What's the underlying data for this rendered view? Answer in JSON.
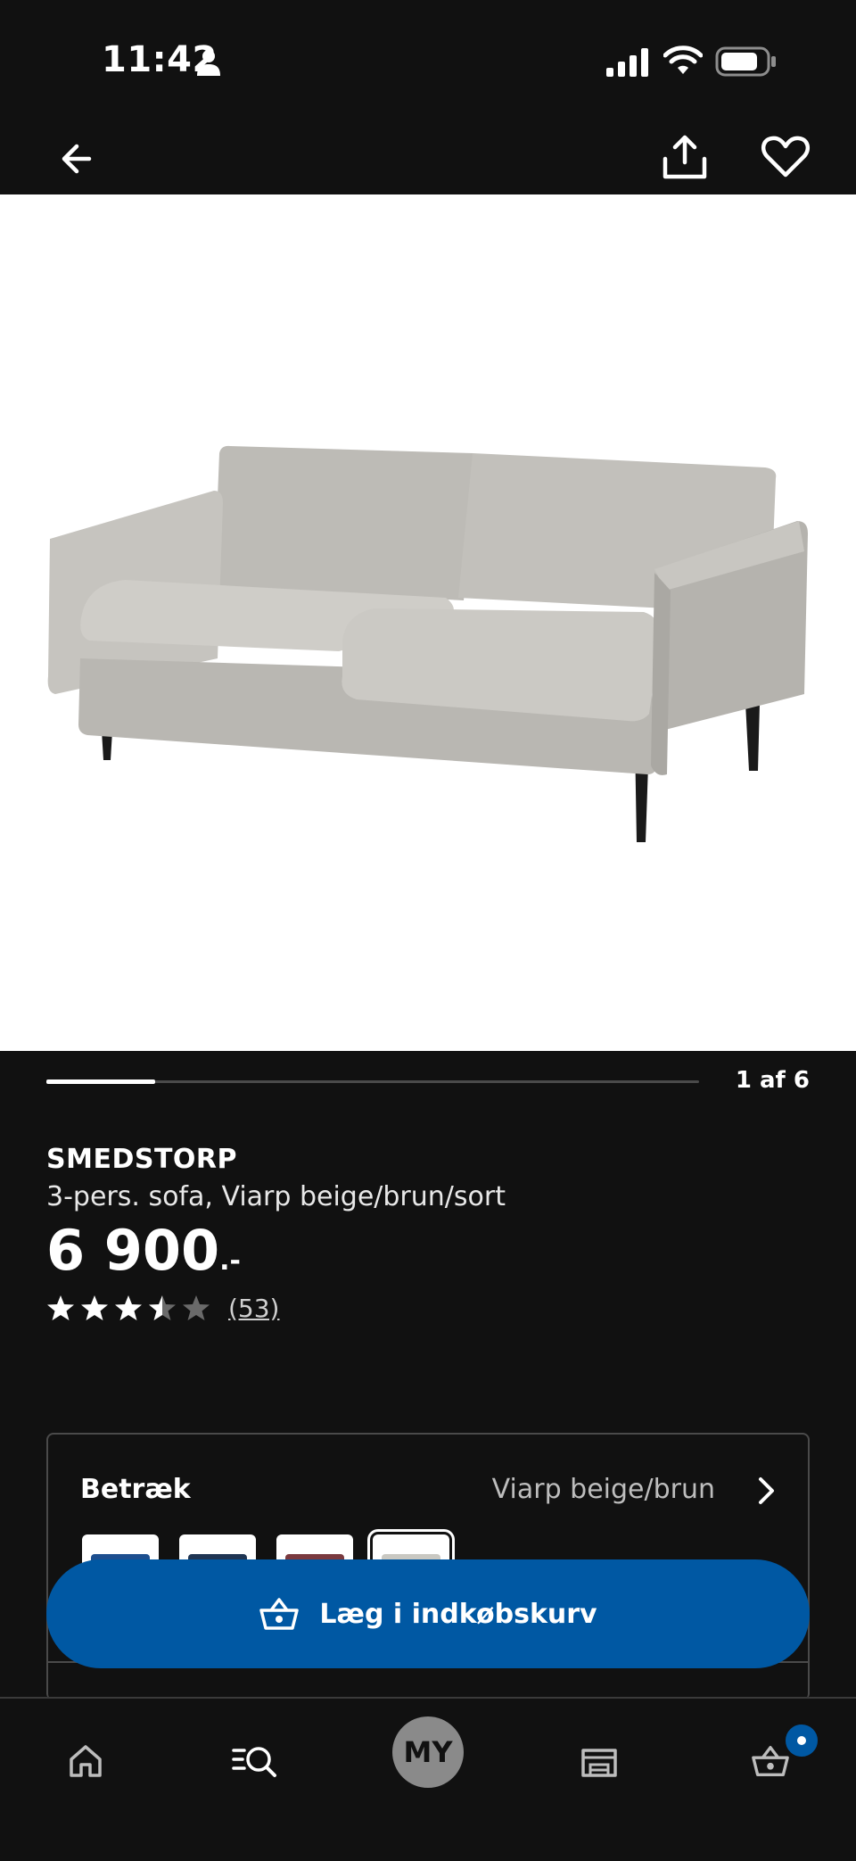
{
  "status_bar": {
    "time": "11:42"
  },
  "carousel": {
    "counter": "1 af 6",
    "current": 1,
    "total": 6
  },
  "product": {
    "name": "SMEDSTORP",
    "description": "3-pers. sofa, Viarp beige/brun/sort",
    "price": "6 900",
    "price_suffix": ".-",
    "rating": 3.5,
    "rating_max": 5,
    "review_count": "(53)"
  },
  "options": {
    "cover_label": "Betræk",
    "cover_value": "Viarp beige/brun",
    "swatches": [
      {
        "color": "#1d4f8f"
      },
      {
        "color": "#1f3553"
      },
      {
        "color": "#7a3a3f"
      },
      {
        "color": "#c9c8c2"
      }
    ]
  },
  "cart_button": {
    "label": "Læg i indkøbskurv"
  },
  "bottom_nav": {
    "my_label": "MY"
  },
  "colors": {
    "background": "#111111",
    "accent": "#0058a3",
    "image_bg": "#ffffff"
  }
}
